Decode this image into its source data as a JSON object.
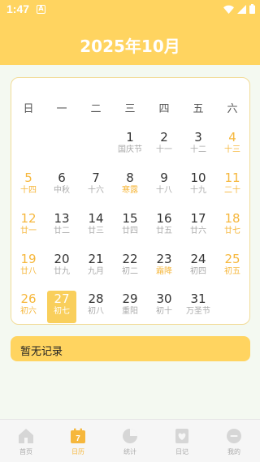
{
  "status_bar": {
    "time": "1:47",
    "notification_glyph": "A"
  },
  "header": {
    "title": "2025年10月"
  },
  "calendar": {
    "weekdays": [
      "日",
      "一",
      "二",
      "三",
      "四",
      "五",
      "六"
    ],
    "days": [
      {
        "day": "1",
        "lunar": "国庆节",
        "weekday": 3,
        "week": 0
      },
      {
        "day": "2",
        "lunar": "十一",
        "weekday": 4,
        "week": 0
      },
      {
        "day": "3",
        "lunar": "十二",
        "weekday": 5,
        "week": 0
      },
      {
        "day": "4",
        "lunar": "十三",
        "weekday": 6,
        "week": 0
      },
      {
        "day": "5",
        "lunar": "十四",
        "weekday": 0,
        "week": 1
      },
      {
        "day": "6",
        "lunar": "中秋",
        "weekday": 1,
        "week": 1
      },
      {
        "day": "7",
        "lunar": "十六",
        "weekday": 2,
        "week": 1
      },
      {
        "day": "8",
        "lunar": "寒露",
        "weekday": 3,
        "week": 1,
        "solar_term": true
      },
      {
        "day": "9",
        "lunar": "十八",
        "weekday": 4,
        "week": 1
      },
      {
        "day": "10",
        "lunar": "十九",
        "weekday": 5,
        "week": 1
      },
      {
        "day": "11",
        "lunar": "二十",
        "weekday": 6,
        "week": 1
      },
      {
        "day": "12",
        "lunar": "廿一",
        "weekday": 0,
        "week": 2
      },
      {
        "day": "13",
        "lunar": "廿二",
        "weekday": 1,
        "week": 2
      },
      {
        "day": "14",
        "lunar": "廿三",
        "weekday": 2,
        "week": 2
      },
      {
        "day": "15",
        "lunar": "廿四",
        "weekday": 3,
        "week": 2
      },
      {
        "day": "16",
        "lunar": "廿五",
        "weekday": 4,
        "week": 2
      },
      {
        "day": "17",
        "lunar": "廿六",
        "weekday": 5,
        "week": 2
      },
      {
        "day": "18",
        "lunar": "廿七",
        "weekday": 6,
        "week": 2
      },
      {
        "day": "19",
        "lunar": "廿八",
        "weekday": 0,
        "week": 3
      },
      {
        "day": "20",
        "lunar": "廿九",
        "weekday": 1,
        "week": 3
      },
      {
        "day": "21",
        "lunar": "九月",
        "weekday": 2,
        "week": 3
      },
      {
        "day": "22",
        "lunar": "初二",
        "weekday": 3,
        "week": 3
      },
      {
        "day": "23",
        "lunar": "霜降",
        "weekday": 4,
        "week": 3,
        "solar_term": true
      },
      {
        "day": "24",
        "lunar": "初四",
        "weekday": 5,
        "week": 3
      },
      {
        "day": "25",
        "lunar": "初五",
        "weekday": 6,
        "week": 3
      },
      {
        "day": "26",
        "lunar": "初六",
        "weekday": 0,
        "week": 4
      },
      {
        "day": "27",
        "lunar": "初七",
        "weekday": 1,
        "week": 4,
        "selected": true
      },
      {
        "day": "28",
        "lunar": "初八",
        "weekday": 2,
        "week": 4
      },
      {
        "day": "29",
        "lunar": "重阳",
        "weekday": 3,
        "week": 4
      },
      {
        "day": "30",
        "lunar": "初十",
        "weekday": 4,
        "week": 4
      },
      {
        "day": "31",
        "lunar": "万圣节",
        "weekday": 5,
        "week": 4
      }
    ]
  },
  "records": {
    "empty_message": "暂无记录"
  },
  "tab_bar": {
    "items": [
      {
        "label": "首页",
        "icon": "home-icon"
      },
      {
        "label": "日历",
        "icon": "calendar-icon",
        "active": true,
        "badge": "7"
      },
      {
        "label": "统计",
        "icon": "pie-chart-icon"
      },
      {
        "label": "日记",
        "icon": "diary-icon"
      },
      {
        "label": "我的",
        "icon": "profile-icon"
      }
    ]
  },
  "colors": {
    "accent": "#ffd460",
    "weekend": "#f6b73c",
    "selected": "#f9cf5c",
    "inactive_icon": "#d6d6d6",
    "background": "#f4f9f1"
  }
}
